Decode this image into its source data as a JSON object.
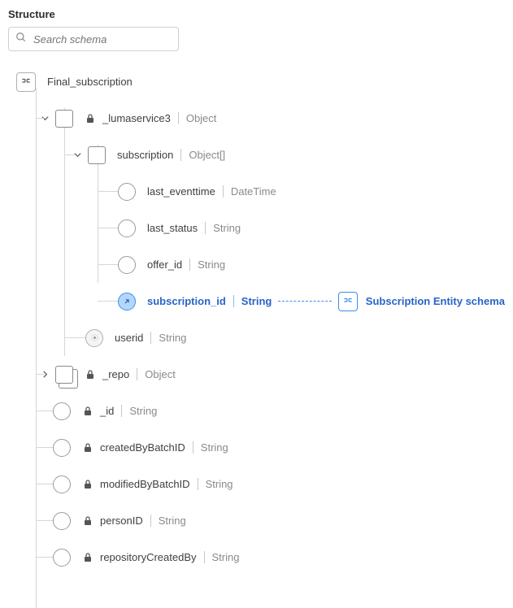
{
  "section_title": "Structure",
  "search": {
    "placeholder": "Search schema"
  },
  "root": {
    "label": "Final_subscription"
  },
  "luma": {
    "label": "_lumaservice3",
    "type": "Object"
  },
  "subscription": {
    "label": "subscription",
    "type": "Object[]"
  },
  "fields": {
    "last_eventtime": {
      "label": "last_eventtime",
      "type": "DateTime"
    },
    "last_status": {
      "label": "last_status",
      "type": "String"
    },
    "offer_id": {
      "label": "offer_id",
      "type": "String"
    },
    "subscription_id": {
      "label": "subscription_id",
      "type": "String"
    },
    "userid": {
      "label": "userid",
      "type": "String"
    }
  },
  "repo": {
    "label": "_repo",
    "type": "Object"
  },
  "top_fields": {
    "_id": {
      "label": "_id",
      "type": "String"
    },
    "createdByBatchID": {
      "label": "createdByBatchID",
      "type": "String"
    },
    "modifiedByBatchID": {
      "label": "modifiedByBatchID",
      "type": "String"
    },
    "personID": {
      "label": "personID",
      "type": "String"
    },
    "repositoryCreatedBy": {
      "label": "repositoryCreatedBy",
      "type": "String"
    }
  },
  "ref": {
    "label": "Subscription Entity schema"
  }
}
